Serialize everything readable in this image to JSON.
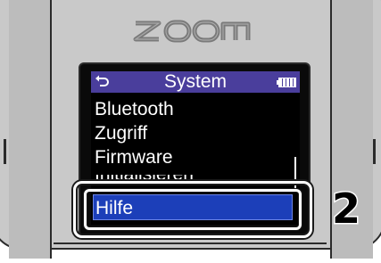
{
  "device": {
    "brand_logo": "ZOOM",
    "colors": {
      "body": "#c9c9c9",
      "title_bar": "#4a3e9c",
      "selection": "#1c3fb9",
      "screen": "#000000"
    }
  },
  "screen": {
    "title": "System",
    "back_icon": "back-arrow-icon",
    "battery_icon": "battery-full-icon",
    "menu_items": [
      {
        "label": "Bluetooth"
      },
      {
        "label": "Zugriff"
      },
      {
        "label": "Firmware"
      },
      {
        "label": "Initialisieren"
      },
      {
        "label": "Hilfe",
        "selected": true
      }
    ]
  },
  "callout": {
    "step_number": "2"
  }
}
